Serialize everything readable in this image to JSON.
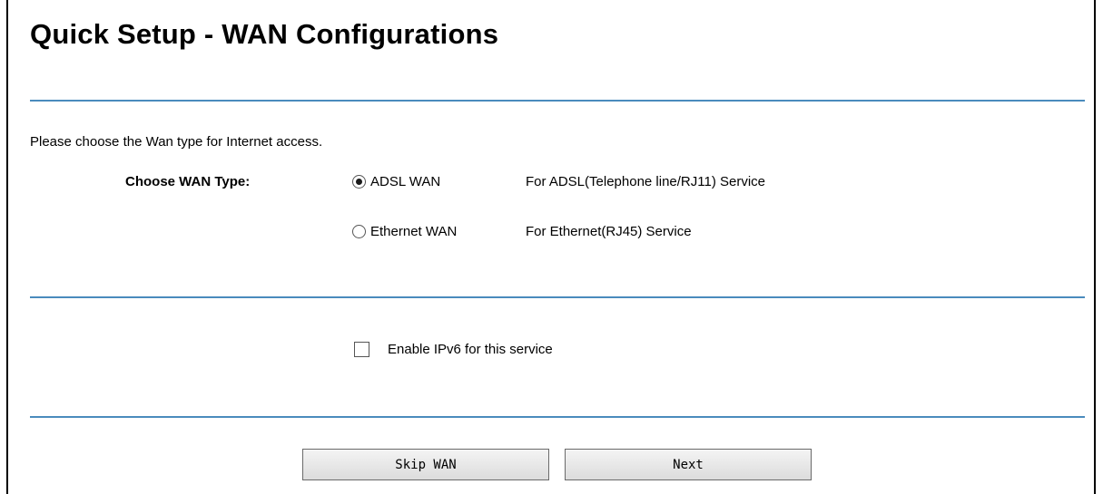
{
  "header": {
    "title": "Quick Setup - WAN Configurations"
  },
  "wan_section": {
    "intro": "Please choose the Wan type for Internet access.",
    "label": "Choose WAN Type:",
    "options": [
      {
        "label": "ADSL WAN",
        "description": "For ADSL(Telephone line/RJ11) Service",
        "selected": true
      },
      {
        "label": "Ethernet WAN",
        "description": "For Ethernet(RJ45) Service",
        "selected": false
      }
    ]
  },
  "ipv6": {
    "label": "Enable IPv6 for this service",
    "checked": false
  },
  "buttons": {
    "skip": "Skip WAN",
    "next": "Next"
  },
  "colors": {
    "divider": "#4a8bbd",
    "button_bg": "#e6e6e6"
  }
}
